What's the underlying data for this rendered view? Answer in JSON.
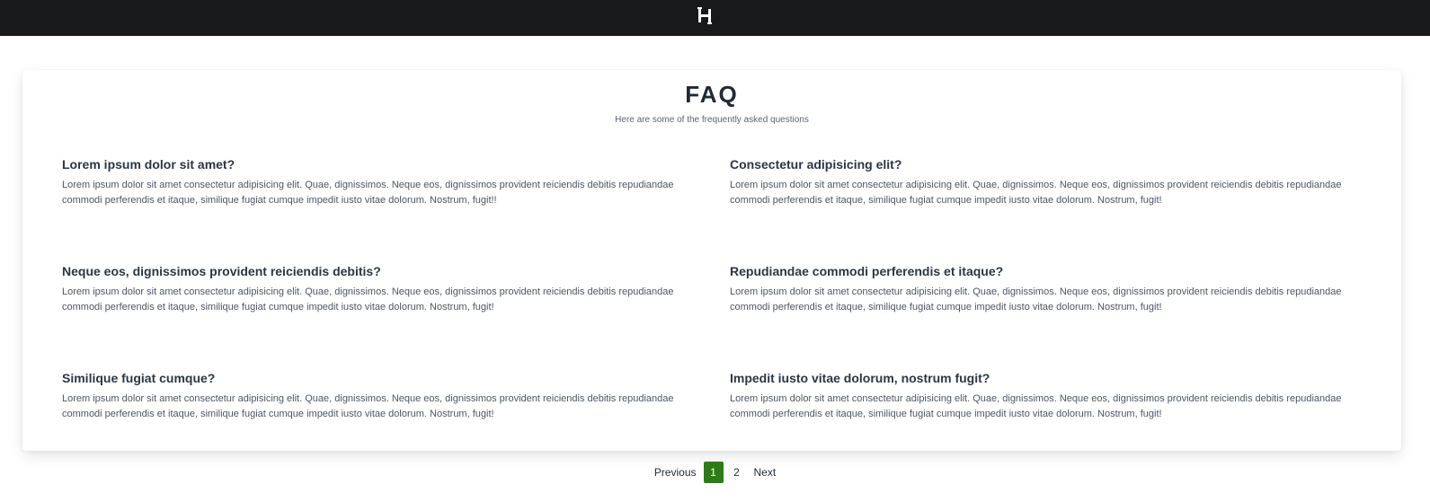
{
  "header": {
    "logo_icon": "h-logo-icon",
    "background": "#18191b"
  },
  "faq": {
    "title": "FAQ",
    "subtitle": "Here are some of the frequently asked questions",
    "items": [
      {
        "question": "Lorem ipsum dolor sit amet?",
        "answer": "Lorem ipsum dolor sit amet consectetur adipisicing elit. Quae, dignissimos. Neque eos, dignissimos provident reiciendis debitis repudiandae commodi perferendis et itaque, similique fugiat cumque impedit iusto vitae dolorum. Nostrum, fugit!!"
      },
      {
        "question": "Consectetur adipisicing elit?",
        "answer": "Lorem ipsum dolor sit amet consectetur adipisicing elit. Quae, dignissimos. Neque eos, dignissimos provident reiciendis debitis repudiandae commodi perferendis et itaque, similique fugiat cumque impedit iusto vitae dolorum. Nostrum, fugit!"
      },
      {
        "question": "Neque eos, dignissimos provident reiciendis debitis?",
        "answer": "Lorem ipsum dolor sit amet consectetur adipisicing elit. Quae, dignissimos. Neque eos, dignissimos provident reiciendis debitis repudiandae commodi perferendis et itaque, similique fugiat cumque impedit iusto vitae dolorum. Nostrum, fugit!"
      },
      {
        "question": "Repudiandae commodi perferendis et itaque?",
        "answer": "Lorem ipsum dolor sit amet consectetur adipisicing elit. Quae, dignissimos. Neque eos, dignissimos provident reiciendis debitis repudiandae commodi perferendis et itaque, similique fugiat cumque impedit iusto vitae dolorum. Nostrum, fugit!"
      },
      {
        "question": "Similique fugiat cumque?",
        "answer": "Lorem ipsum dolor sit amet consectetur adipisicing elit. Quae, dignissimos. Neque eos, dignissimos provident reiciendis debitis repudiandae commodi perferendis et itaque, similique fugiat cumque impedit iusto vitae dolorum. Nostrum, fugit!"
      },
      {
        "question": "Impedit iusto vitae dolorum, nostrum fugit?",
        "answer": "Lorem ipsum dolor sit amet consectetur adipisicing elit. Quae, dignissimos. Neque eos, dignissimos provident reiciendis debitis repudiandae commodi perferendis et itaque, similique fugiat cumque impedit iusto vitae dolorum. Nostrum, fugit!"
      }
    ]
  },
  "pagination": {
    "previous": "Previous",
    "pages": [
      "1",
      "2"
    ],
    "current_page": "1",
    "next": "Next",
    "active_color": "#2c7d16"
  }
}
